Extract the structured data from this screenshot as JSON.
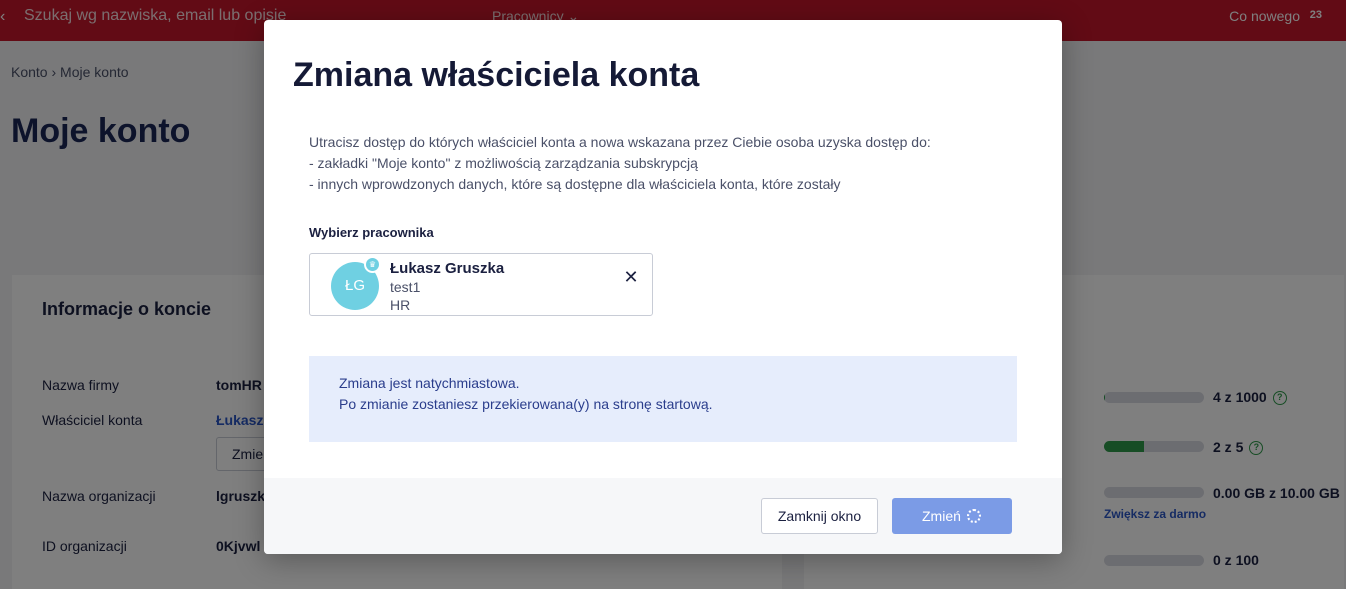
{
  "topbar": {
    "back_icon": "chevron-left-icon",
    "search_placeholder": "Szukaj wg nazwiska, email lub opisie",
    "filter_label": "Pracownicy",
    "news_label": "Co nowego",
    "news_count": "23"
  },
  "breadcrumb": {
    "root": "Konto",
    "current": "Moje konto"
  },
  "page_title": "Moje konto",
  "account_card": {
    "title": "Informacje o koncie",
    "rows": [
      {
        "label": "Nazwa firmy",
        "value": "tomHR"
      },
      {
        "label": "Właściciel konta",
        "value": "Łukasz"
      },
      {
        "label": "Nazwa organizacji",
        "value": "lgruszk"
      },
      {
        "label": "ID organizacji",
        "value": "0Kjvwl"
      }
    ],
    "change_button": "Zmie"
  },
  "quota_card": {
    "items": [
      {
        "text": "4 z 1000",
        "fill": 0.004,
        "help": true
      },
      {
        "text": "2 z 5",
        "fill": 0.4,
        "help": true
      },
      {
        "text": "0.00 GB z 10.00 GB",
        "fill": 0.0,
        "help": false
      },
      {
        "text": "0 z 100",
        "fill": 0.0,
        "help": false
      }
    ],
    "upgrade_link": "Zwiększ za darmo"
  },
  "modal": {
    "title": "Zmiana właściciela konta",
    "description": [
      "Utracisz dostęp do których właściciel konta a nowa wskazana przez Ciebie osoba uzyska dostęp do:",
      "- zakładki \"Moje konto\" z możliwością zarządzania subskrypcją",
      "- innych wprowdzonych danych, które są dostępne dla właściciela konta, które zostały"
    ],
    "field_label": "Wybierz pracownika",
    "employee": {
      "initials": "ŁG",
      "name": "Łukasz Gruszka",
      "line2": "test1",
      "line3": "HR"
    },
    "notice": [
      "Zmiana jest natychmiastowa.",
      "Po zmianie zostaniesz przekierowana(y) na stronę startową."
    ],
    "close_button": "Zamknij okno",
    "confirm_button": "Zmień"
  },
  "colors": {
    "topbar": "#c4162a",
    "accent": "#2a56c6",
    "avatar": "#6fd0e2",
    "notice_bg": "#e6edfc",
    "confirm_button": "#7b9be6"
  }
}
